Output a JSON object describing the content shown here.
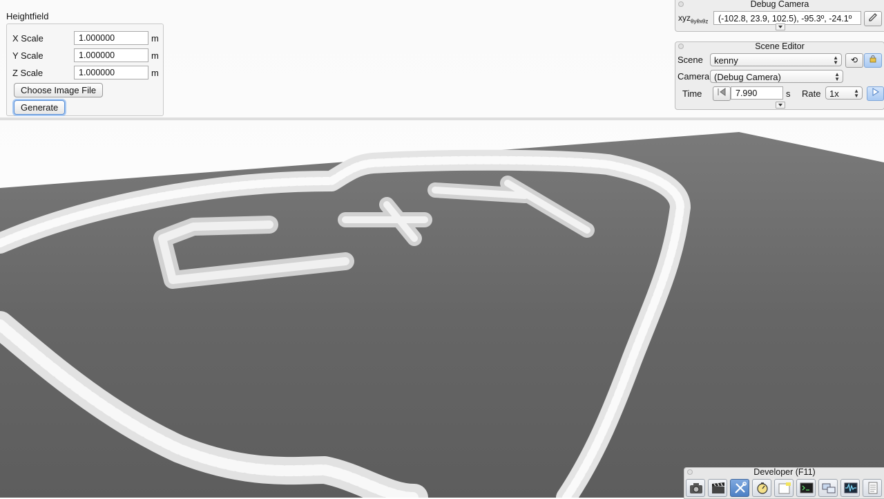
{
  "heightfield": {
    "title": "Heightfield",
    "rows": [
      {
        "label": "X Scale",
        "value": "1.000000",
        "unit": "m"
      },
      {
        "label": "Y Scale",
        "value": "1.000000",
        "unit": "m"
      },
      {
        "label": "Z Scale",
        "value": "1.000000",
        "unit": "m"
      }
    ],
    "choose_image_label": "Choose Image File",
    "generate_label": "Generate"
  },
  "debug_camera": {
    "title": "Debug Camera",
    "coords_label": "xyz",
    "angle_sub": "θyθxθz",
    "value": "(-102.8,  23.9,  102.5), -95.3º, -24.1º"
  },
  "scene_editor": {
    "title": "Scene Editor",
    "scene_label": "Scene",
    "scene_value": "kenny",
    "camera_label": "Camera",
    "camera_value": "(Debug Camera)",
    "time_label": "Time",
    "time_value": "7.990",
    "time_unit": "s",
    "rate_label": "Rate",
    "rate_value": "1x"
  },
  "developer": {
    "title": "Developer (F11)",
    "tools": [
      "camera-icon",
      "clapperboard-icon",
      "tools-icon",
      "stopwatch-icon",
      "notes-icon",
      "terminal-icon",
      "windows-icon",
      "waveform-icon",
      "document-icon"
    ]
  },
  "colors": {
    "ground": "#6e6e6e",
    "terrain_ridge": "#e8e8e8",
    "selection_blue": "#a6c8f3"
  }
}
